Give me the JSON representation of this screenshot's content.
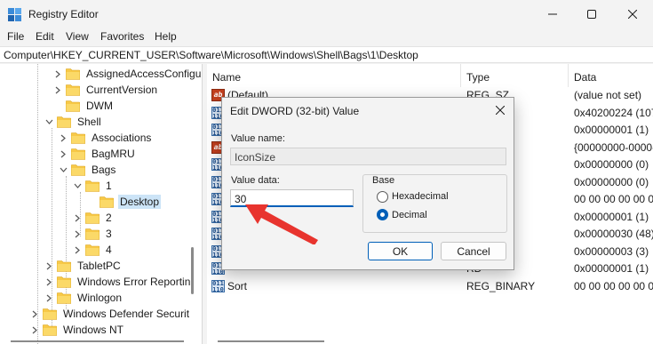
{
  "window": {
    "title": "Registry Editor",
    "icon": "registry-editor-icon"
  },
  "menu": [
    "File",
    "Edit",
    "View",
    "Favorites",
    "Help"
  ],
  "address": "Computer\\HKEY_CURRENT_USER\\Software\\Microsoft\\Windows\\Shell\\Bags\\1\\Desktop",
  "tree": [
    {
      "label": "AssignedAccessConfigu",
      "chevron": "right"
    },
    {
      "label": "CurrentVersion",
      "chevron": "right"
    },
    {
      "label": "DWM",
      "chevron": "none"
    },
    {
      "label": "Shell",
      "chevron": "down"
    },
    {
      "label": "Associations",
      "chevron": "right"
    },
    {
      "label": "BagMRU",
      "chevron": "right"
    },
    {
      "label": "Bags",
      "chevron": "down"
    },
    {
      "label": "1",
      "chevron": "down"
    },
    {
      "label": "Desktop",
      "chevron": "none",
      "selected": true
    },
    {
      "label": "2",
      "chevron": "right"
    },
    {
      "label": "3",
      "chevron": "right"
    },
    {
      "label": "4",
      "chevron": "right"
    },
    {
      "label": "TabletPC",
      "chevron": "right"
    },
    {
      "label": "Windows Error Reportin",
      "chevron": "right"
    },
    {
      "label": "Winlogon",
      "chevron": "right"
    },
    {
      "label": "Windows Defender Securit",
      "chevron": "right"
    },
    {
      "label": "Windows NT",
      "chevron": "right"
    }
  ],
  "columns": {
    "name": "Name",
    "type": "Type",
    "data": "Data"
  },
  "values": [
    {
      "name": "(Default)",
      "type": "REG_SZ",
      "data": "(value not set)",
      "icon": "string-value-icon"
    },
    {
      "name": "",
      "type": "RD",
      "data": "0x40200224 (1075",
      "icon": "binary-value-icon"
    },
    {
      "name": "",
      "type": "RD",
      "data": "0x00000001 (1)",
      "icon": "binary-value-icon"
    },
    {
      "name": "",
      "type": "",
      "data": "{00000000-0000-0",
      "icon": "string-value-icon"
    },
    {
      "name": "",
      "type": "RD",
      "data": "0x00000000 (0)",
      "icon": "binary-value-icon"
    },
    {
      "name": "",
      "type": "RD",
      "data": "0x00000000 (0)",
      "icon": "binary-value-icon"
    },
    {
      "name": "",
      "type": "IARY",
      "data": "00 00 00 00 00 00",
      "icon": "binary-value-icon"
    },
    {
      "name": "",
      "type": "RD",
      "data": "0x00000001 (1)",
      "icon": "binary-value-icon"
    },
    {
      "name": "",
      "type": "RD",
      "data": "0x00000030 (48)",
      "icon": "binary-value-icon"
    },
    {
      "name": "",
      "type": "RD",
      "data": "0x00000003 (3)",
      "icon": "binary-value-icon"
    },
    {
      "name": "",
      "type": "RD",
      "data": "0x00000001 (1)",
      "icon": "binary-value-icon"
    },
    {
      "name": "Sort",
      "type": "REG_BINARY",
      "data": "00 00 00 00 00 00",
      "icon": "binary-value-icon"
    }
  ],
  "dialog": {
    "title": "Edit DWORD (32-bit) Value",
    "value_name_label": "Value name:",
    "value_name": "IconSize",
    "value_data_label": "Value data:",
    "value_data": "30",
    "base_label": "Base",
    "hex_label": "Hexadecimal",
    "dec_label": "Decimal",
    "selected_base": "Decimal",
    "ok": "OK",
    "cancel": "Cancel"
  },
  "colors": {
    "accent": "#005fb8",
    "selection": "#cce4f7",
    "arrow": "#e8342e",
    "folder": "#f7c948"
  }
}
